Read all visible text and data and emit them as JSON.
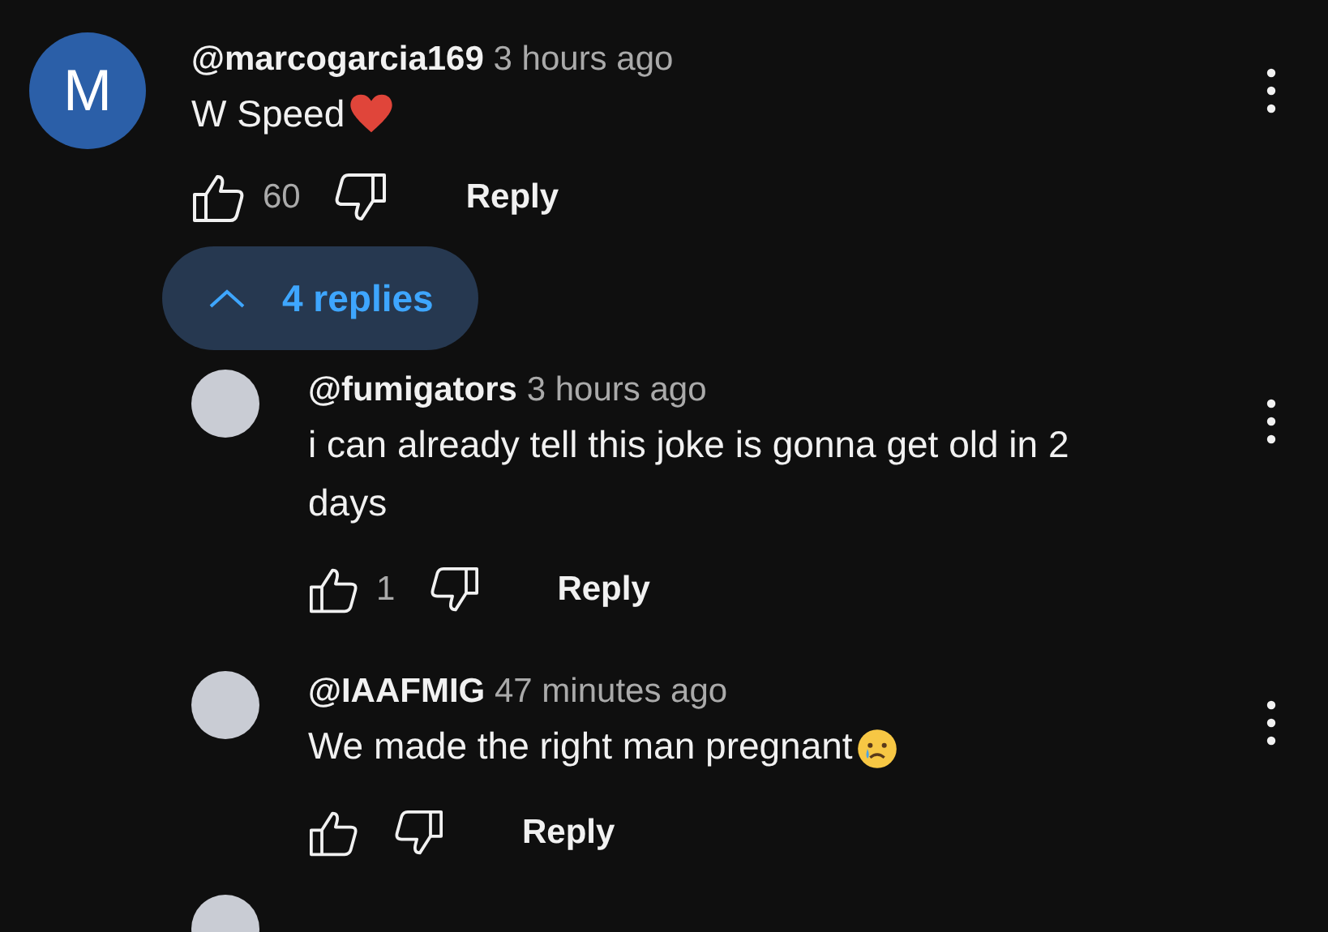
{
  "comment": {
    "avatar_letter": "M",
    "username": "@marcogarcia169",
    "time": "3 hours ago",
    "text": "W Speed",
    "emoji": {
      "kind": "heart"
    },
    "likes": "60",
    "reply_label": "Reply",
    "replies_toggle": {
      "label": "4 replies",
      "expanded": true
    },
    "replies": [
      {
        "username": "@fumigators",
        "time": "3 hours ago",
        "text": "i can already tell this joke is gonna get old in 2 days",
        "likes": "1",
        "reply_label": "Reply"
      },
      {
        "username": "@IAAFMIG",
        "time": "47 minutes ago",
        "text": "We made the right man pregnant",
        "emoji": {
          "kind": "crying"
        },
        "reply_label": "Reply"
      }
    ],
    "next_reply_peek": true
  }
}
